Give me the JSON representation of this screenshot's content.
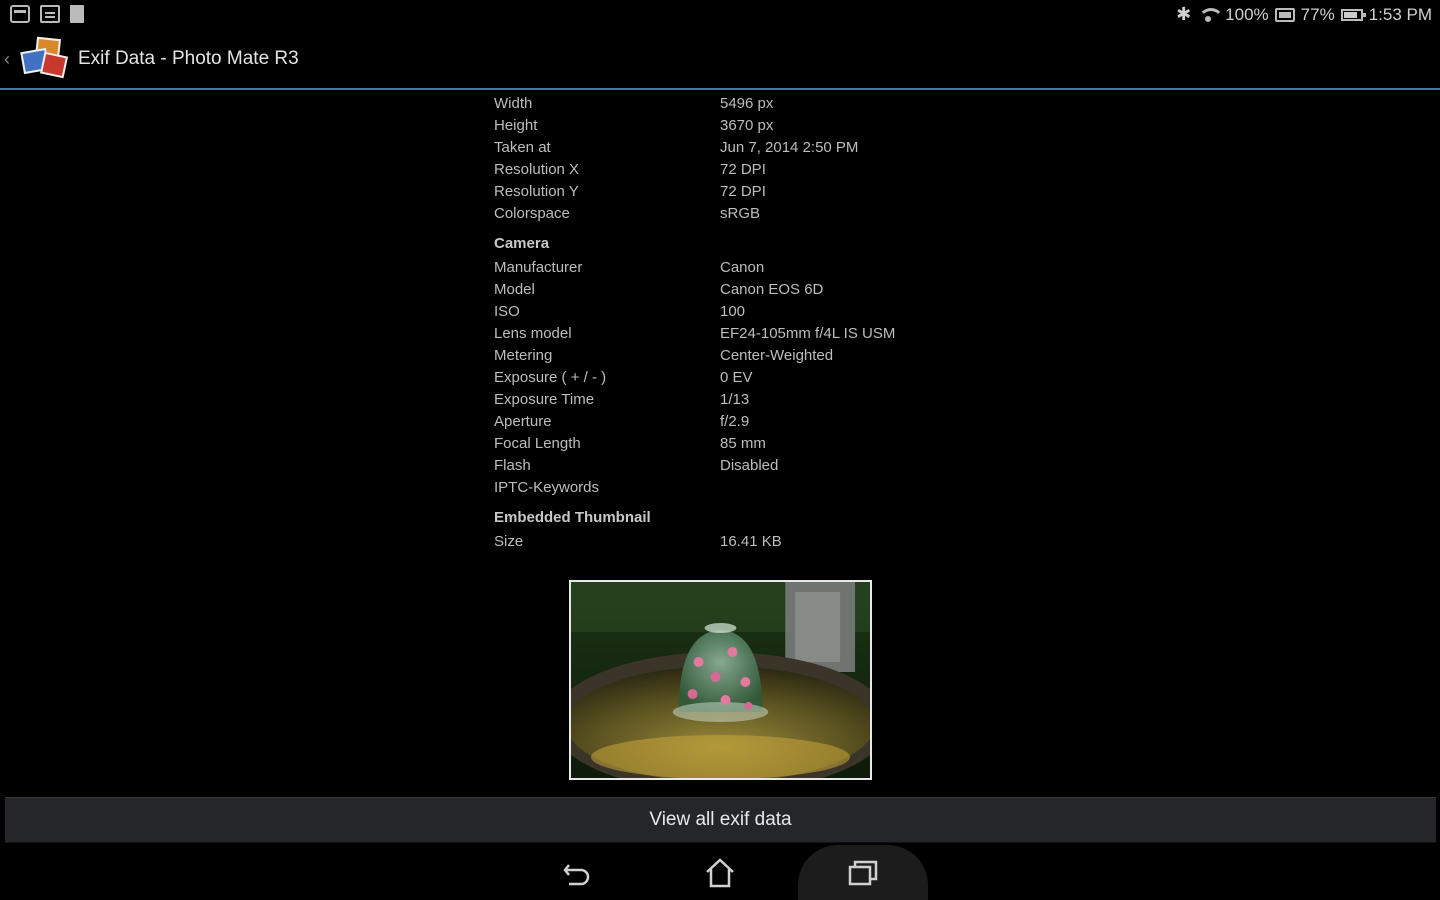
{
  "status_bar": {
    "wifi_percent": "100%",
    "battery_percent": "77%",
    "time": "1:53 PM"
  },
  "action_bar": {
    "title": "Exif Data - Photo Mate R3"
  },
  "image_info": [
    {
      "key": "Width",
      "value": "5496 px"
    },
    {
      "key": "Height",
      "value": "3670 px"
    },
    {
      "key": "Taken at",
      "value": "Jun 7, 2014 2:50 PM"
    },
    {
      "key": "Resolution X",
      "value": "72 DPI"
    },
    {
      "key": "Resolution Y",
      "value": "72 DPI"
    },
    {
      "key": "Colorspace",
      "value": "sRGB"
    }
  ],
  "camera": {
    "title": "Camera",
    "rows": [
      {
        "key": "Manufacturer",
        "value": "Canon"
      },
      {
        "key": "Model",
        "value": "Canon EOS 6D"
      },
      {
        "key": "ISO",
        "value": "100"
      },
      {
        "key": "Lens model",
        "value": "EF24-105mm f/4L IS USM"
      },
      {
        "key": "Metering",
        "value": "Center-Weighted"
      },
      {
        "key": "Exposure ( + / - )",
        "value": "0 EV"
      },
      {
        "key": "Exposure Time",
        "value": "1/13"
      },
      {
        "key": "Aperture",
        "value": "f/2.9"
      },
      {
        "key": "Focal Length",
        "value": "85 mm"
      },
      {
        "key": "Flash",
        "value": "Disabled"
      },
      {
        "key": "IPTC-Keywords",
        "value": ""
      }
    ]
  },
  "thumbnail": {
    "title": "Embedded Thumbnail",
    "rows": [
      {
        "key": "Size",
        "value": "16.41 KB"
      }
    ]
  },
  "view_all_label": "View all exif data"
}
